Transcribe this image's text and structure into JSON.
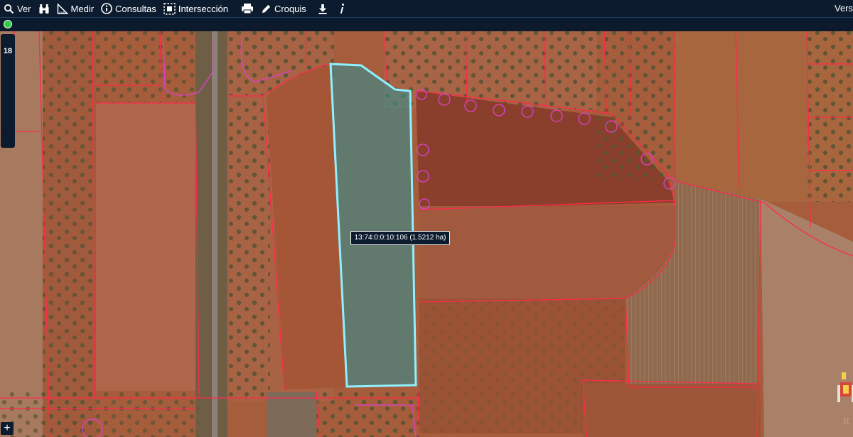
{
  "toolbar": {
    "items": [
      {
        "label": "Ver",
        "icon": "search-icon"
      },
      {
        "label": "",
        "icon": "binoculars-icon"
      },
      {
        "label": "Medir",
        "icon": "ruler-icon"
      },
      {
        "label": "Consultas",
        "icon": "info-circle-icon"
      },
      {
        "label": "Intersección",
        "icon": "intersection-icon"
      },
      {
        "label": "",
        "icon": "print-icon"
      },
      {
        "label": "Croquis",
        "icon": "pencil-icon"
      },
      {
        "label": "",
        "icon": "download-icon"
      },
      {
        "label": "",
        "icon": "italic-info-icon"
      }
    ],
    "version_label": "Vers"
  },
  "map": {
    "zoom_level": "18",
    "selected_parcel_label": "13:74:0:0:10:106 (1.5212 ha)",
    "status_color": "#2ecc40",
    "selection_color": "#8ff0ff",
    "parcel_border_color": "#ff2a4a",
    "tree_ring_color": "#e040d0"
  },
  "controls": {
    "add_symbol": "+"
  },
  "logo": {
    "text": "R"
  }
}
